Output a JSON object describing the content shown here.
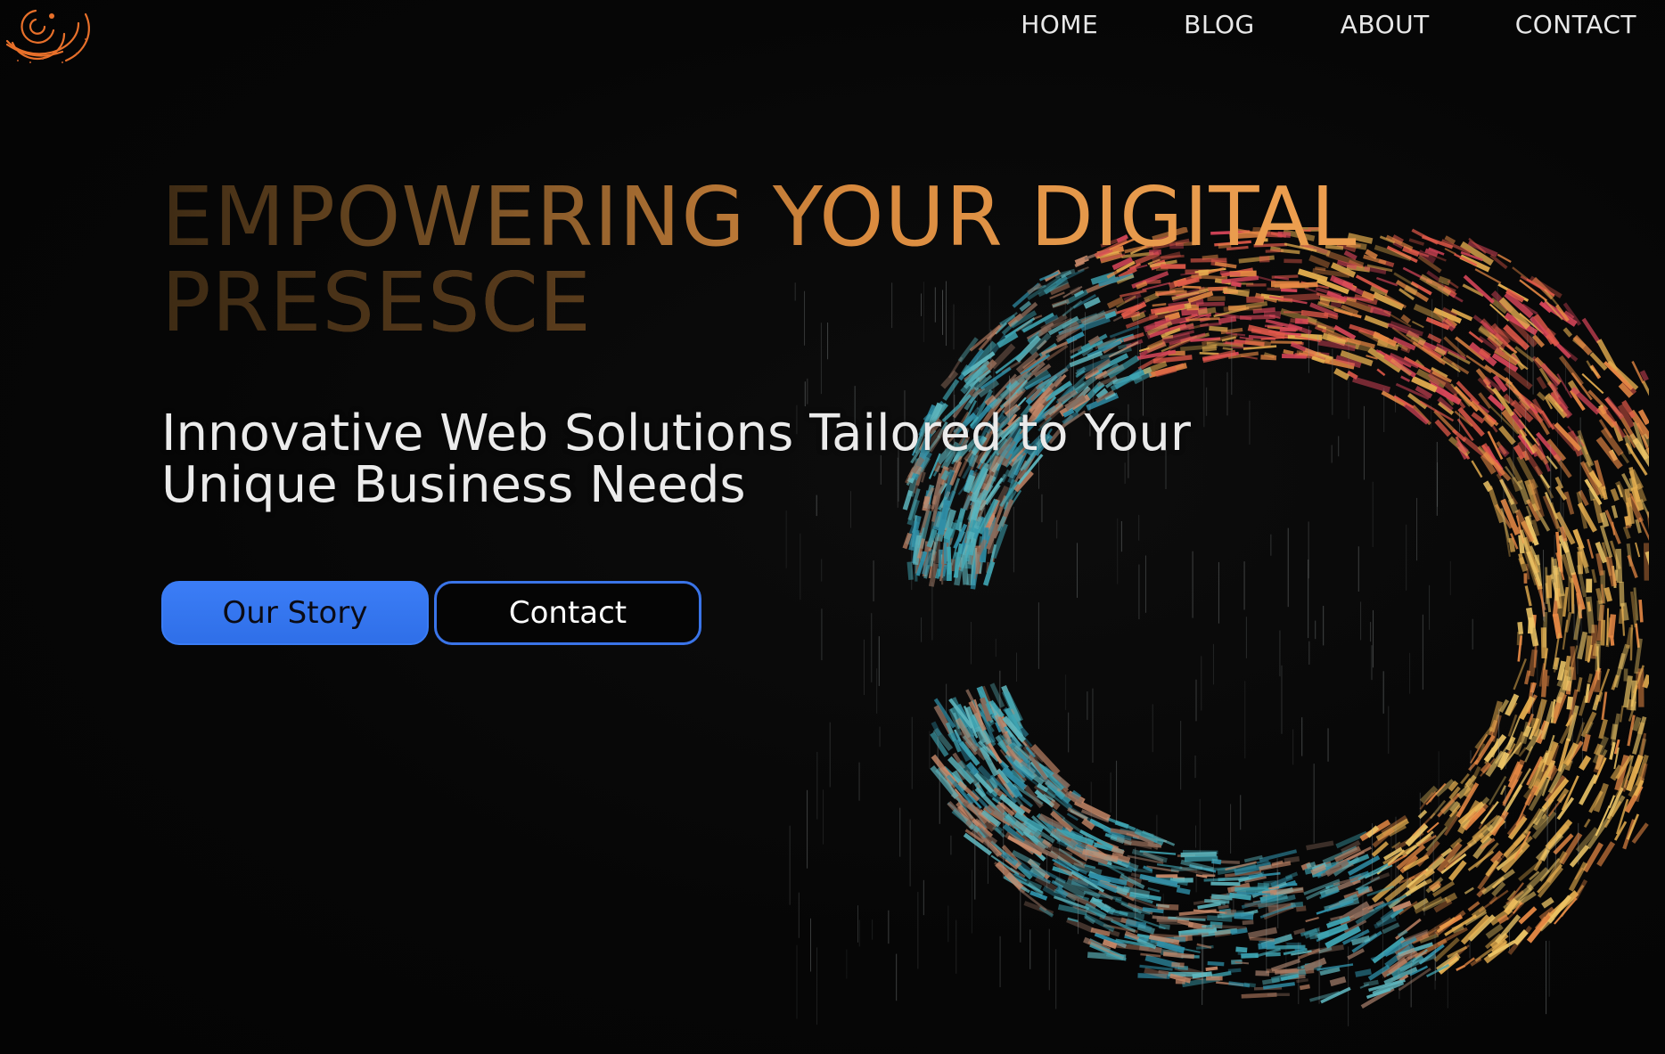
{
  "nav": {
    "items": [
      {
        "label": "HOME"
      },
      {
        "label": "BLOG"
      },
      {
        "label": "ABOUT"
      },
      {
        "label": "CONTACT"
      }
    ]
  },
  "hero": {
    "headline_line1": "EMPOWERING YOUR DIGITAL",
    "headline_line2": "PRESESCE",
    "subheadline_line1": "Innovative Web Solutions Tailored to Your",
    "subheadline_line2": "Unique Business Needs",
    "primary_button": "Our Story",
    "secondary_button": "Contact"
  },
  "colors": {
    "background": "#060606",
    "accent_orange": "#e69a4c",
    "button_blue": "#3b7df6"
  },
  "icons": {
    "logo": "orange-spiral-logo"
  }
}
